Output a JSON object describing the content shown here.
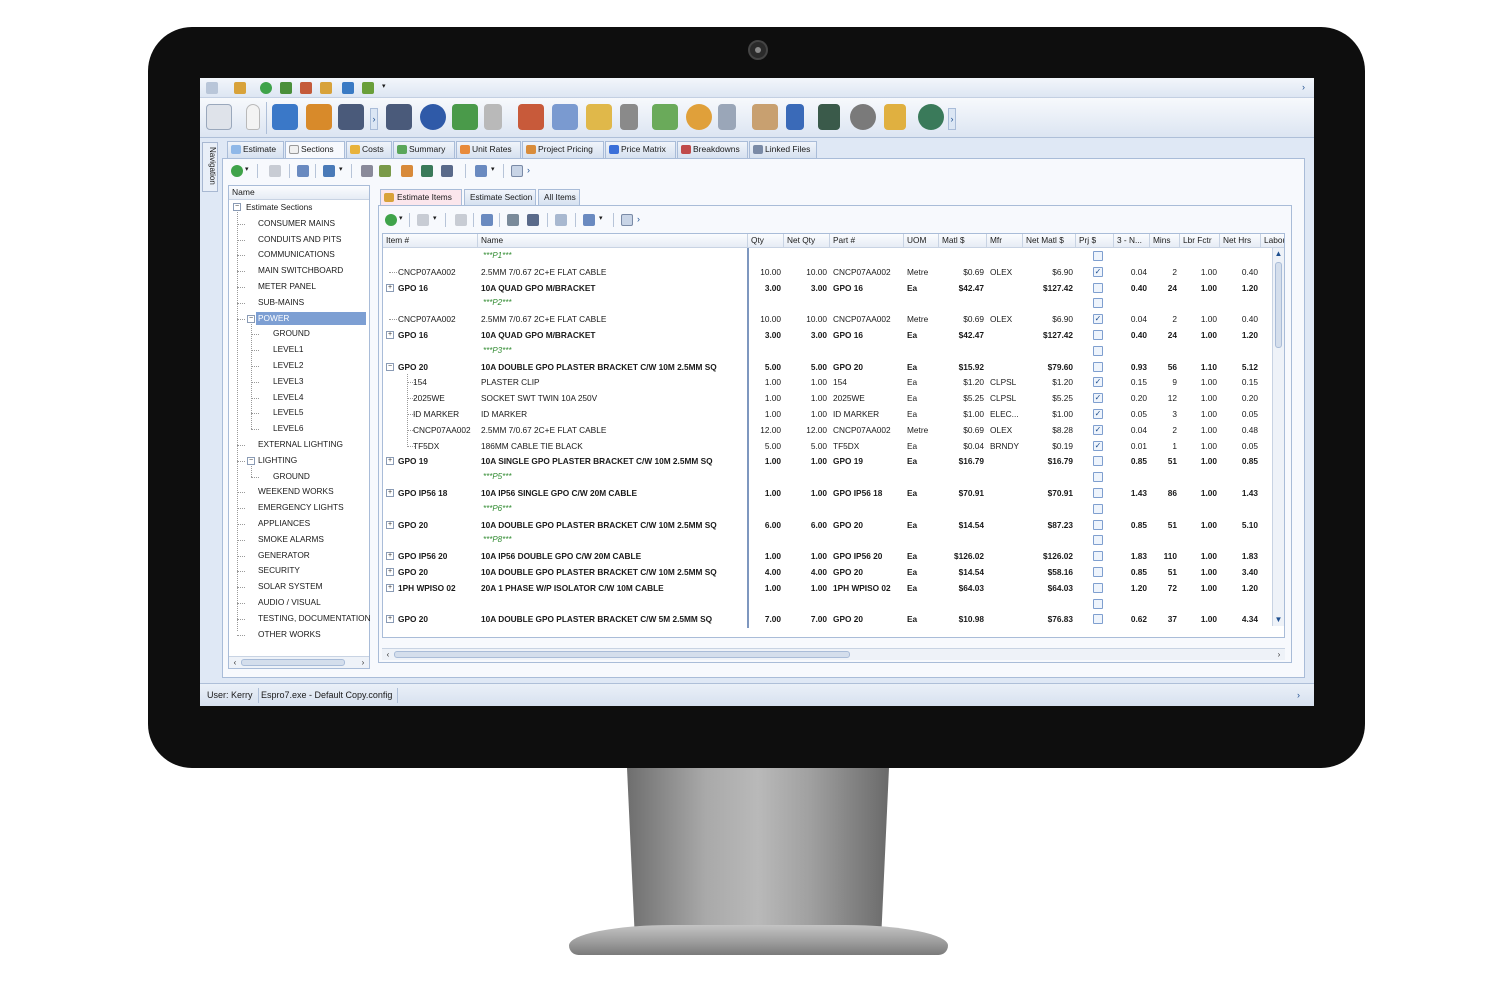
{
  "tabs": [
    {
      "label": "Estimate",
      "color": "#8fb8e8"
    },
    {
      "label": "Sections",
      "color": "#e06a8a"
    },
    {
      "label": "Costs",
      "color": "#e8b23a"
    },
    {
      "label": "Summary",
      "color": "#5aa65a"
    },
    {
      "label": "Unit Rates",
      "color": "#e88a3a"
    },
    {
      "label": "Project Pricing",
      "color": "#d98c3a"
    },
    {
      "label": "Price Matrix",
      "color": "#3a6fd9"
    },
    {
      "label": "Breakdowns",
      "color": "#c04a4a"
    },
    {
      "label": "Linked Files",
      "color": "#7a8aa6"
    }
  ],
  "active_tab": "Sections",
  "nav_label": "Navigation",
  "tree": {
    "header": "Name",
    "root": "Estimate Sections",
    "nodes": [
      {
        "label": "CONSUMER MAINS",
        "level": 1
      },
      {
        "label": "CONDUITS AND PITS",
        "level": 1
      },
      {
        "label": "COMMUNICATIONS",
        "level": 1
      },
      {
        "label": "MAIN SWITCHBOARD",
        "level": 1
      },
      {
        "label": "METER PANEL",
        "level": 1
      },
      {
        "label": "SUB-MAINS",
        "level": 1
      },
      {
        "label": "POWER",
        "level": 1,
        "expanded": true,
        "selected": true
      },
      {
        "label": "GROUND",
        "level": 2
      },
      {
        "label": "LEVEL1",
        "level": 2
      },
      {
        "label": "LEVEL2",
        "level": 2
      },
      {
        "label": "LEVEL3",
        "level": 2
      },
      {
        "label": "LEVEL4",
        "level": 2
      },
      {
        "label": "LEVEL5",
        "level": 2
      },
      {
        "label": "LEVEL6",
        "level": 2
      },
      {
        "label": "EXTERNAL LIGHTING",
        "level": 1
      },
      {
        "label": "LIGHTING",
        "level": 1,
        "expanded": true
      },
      {
        "label": "GROUND",
        "level": 2
      },
      {
        "label": "WEEKEND WORKS",
        "level": 1
      },
      {
        "label": "EMERGENCY LIGHTS",
        "level": 1
      },
      {
        "label": "APPLIANCES",
        "level": 1
      },
      {
        "label": "SMOKE ALARMS",
        "level": 1
      },
      {
        "label": "GENERATOR",
        "level": 1
      },
      {
        "label": "SECURITY",
        "level": 1
      },
      {
        "label": "SOLAR SYSTEM",
        "level": 1
      },
      {
        "label": "AUDIO / VISUAL",
        "level": 1
      },
      {
        "label": "TESTING, DOCUMENTATION",
        "level": 1
      },
      {
        "label": "OTHER WORKS",
        "level": 1
      }
    ]
  },
  "subtabs": [
    "Estimate Items",
    "Estimate Section",
    "All Items"
  ],
  "active_subtab": "Estimate Items",
  "grid": {
    "columns": [
      "Item #",
      "Name",
      "Qty",
      "Net Qty",
      "Part #",
      "UOM",
      "Matl $",
      "Mfr",
      "Net Matl $",
      "Prj $",
      "3 - N...",
      "Mins",
      "Lbr Fctr",
      "Net Hrs",
      "Labou"
    ],
    "rows": [
      {
        "kind": "p",
        "tag": "***P1***"
      },
      {
        "kind": "child",
        "item": "CNCP07AA002",
        "name": "2.5MM 7/0.67 2C+E FLAT CABLE",
        "qty": "10.00",
        "netqty": "10.00",
        "part": "CNCP07AA002",
        "uom": "Metre",
        "matl": "$0.69",
        "mfr": "OLEX",
        "netmatl": "$6.90",
        "prj": true,
        "n3": "0.04",
        "mins": "2",
        "lbr": "1.00",
        "nethrs": "0.40"
      },
      {
        "kind": "bold",
        "item": "GPO 16",
        "name": "10A QUAD GPO M/BRACKET",
        "qty": "3.00",
        "netqty": "3.00",
        "part": "GPO 16",
        "uom": "Ea",
        "matl": "$42.47",
        "mfr": "",
        "netmatl": "$127.42",
        "prj": false,
        "n3": "0.40",
        "mins": "24",
        "lbr": "1.00",
        "nethrs": "1.20"
      },
      {
        "kind": "p",
        "tag": "***P2***"
      },
      {
        "kind": "child",
        "item": "CNCP07AA002",
        "name": "2.5MM 7/0.67 2C+E FLAT CABLE",
        "qty": "10.00",
        "netqty": "10.00",
        "part": "CNCP07AA002",
        "uom": "Metre",
        "matl": "$0.69",
        "mfr": "OLEX",
        "netmatl": "$6.90",
        "prj": true,
        "n3": "0.04",
        "mins": "2",
        "lbr": "1.00",
        "nethrs": "0.40"
      },
      {
        "kind": "bold",
        "item": "GPO 16",
        "name": "10A QUAD GPO M/BRACKET",
        "qty": "3.00",
        "netqty": "3.00",
        "part": "GPO 16",
        "uom": "Ea",
        "matl": "$42.47",
        "mfr": "",
        "netmatl": "$127.42",
        "prj": false,
        "n3": "0.40",
        "mins": "24",
        "lbr": "1.00",
        "nethrs": "1.20"
      },
      {
        "kind": "p",
        "tag": "***P3***"
      },
      {
        "kind": "bold",
        "expanded": true,
        "item": "GPO 20",
        "name": "10A DOUBLE GPO PLASTER BRACKET C/W 10M 2.5MM SQ",
        "qty": "5.00",
        "netqty": "5.00",
        "part": "GPO 20",
        "uom": "Ea",
        "matl": "$15.92",
        "mfr": "",
        "netmatl": "$79.60",
        "prj": false,
        "n3": "0.93",
        "mins": "56",
        "lbr": "1.10",
        "nethrs": "5.12"
      },
      {
        "kind": "sub",
        "item": "154",
        "name": "PLASTER CLIP",
        "qty": "1.00",
        "netqty": "1.00",
        "part": "154",
        "uom": "Ea",
        "matl": "$1.20",
        "mfr": "CLPSL",
        "netmatl": "$1.20",
        "prj": true,
        "n3": "0.15",
        "mins": "9",
        "lbr": "1.00",
        "nethrs": "0.15"
      },
      {
        "kind": "sub",
        "item": "2025WE",
        "name": "SOCKET SWT TWIN 10A 250V",
        "qty": "1.00",
        "netqty": "1.00",
        "part": "2025WE",
        "uom": "Ea",
        "matl": "$5.25",
        "mfr": "CLPSL",
        "netmatl": "$5.25",
        "prj": true,
        "n3": "0.20",
        "mins": "12",
        "lbr": "1.00",
        "nethrs": "0.20"
      },
      {
        "kind": "sub",
        "item": "ID MARKER",
        "name": "ID MARKER",
        "qty": "1.00",
        "netqty": "1.00",
        "part": "ID MARKER",
        "uom": "Ea",
        "matl": "$1.00",
        "mfr": "ELEC...",
        "netmatl": "$1.00",
        "prj": true,
        "n3": "0.05",
        "mins": "3",
        "lbr": "1.00",
        "nethrs": "0.05"
      },
      {
        "kind": "sub",
        "item": "CNCP07AA002",
        "name": "2.5MM 7/0.67 2C+E FLAT CABLE",
        "qty": "12.00",
        "netqty": "12.00",
        "part": "CNCP07AA002",
        "uom": "Metre",
        "matl": "$0.69",
        "mfr": "OLEX",
        "netmatl": "$8.28",
        "prj": true,
        "n3": "0.04",
        "mins": "2",
        "lbr": "1.00",
        "nethrs": "0.48"
      },
      {
        "kind": "sub",
        "item": "TF5DX",
        "name": "186MM CABLE TIE BLACK",
        "qty": "5.00",
        "netqty": "5.00",
        "part": "TF5DX",
        "uom": "Ea",
        "matl": "$0.04",
        "mfr": "BRNDY",
        "netmatl": "$0.19",
        "prj": true,
        "n3": "0.01",
        "mins": "1",
        "lbr": "1.00",
        "nethrs": "0.05"
      },
      {
        "kind": "bold",
        "item": "GPO 19",
        "name": "10A SINGLE GPO PLASTER BRACKET C/W 10M 2.5MM SQ",
        "qty": "1.00",
        "netqty": "1.00",
        "part": "GPO 19",
        "uom": "Ea",
        "matl": "$16.79",
        "mfr": "",
        "netmatl": "$16.79",
        "prj": false,
        "n3": "0.85",
        "mins": "51",
        "lbr": "1.00",
        "nethrs": "0.85"
      },
      {
        "kind": "p",
        "tag": "***P5***"
      },
      {
        "kind": "bold",
        "item": "GPO IP56 18",
        "name": "10A IP56 SINGLE GPO C/W 20M CABLE",
        "qty": "1.00",
        "netqty": "1.00",
        "part": "GPO IP56 18",
        "uom": "Ea",
        "matl": "$70.91",
        "mfr": "",
        "netmatl": "$70.91",
        "prj": false,
        "n3": "1.43",
        "mins": "86",
        "lbr": "1.00",
        "nethrs": "1.43"
      },
      {
        "kind": "p",
        "tag": "***P6***"
      },
      {
        "kind": "bold",
        "item": "GPO 20",
        "name": "10A DOUBLE GPO PLASTER BRACKET C/W 10M 2.5MM SQ",
        "qty": "6.00",
        "netqty": "6.00",
        "part": "GPO 20",
        "uom": "Ea",
        "matl": "$14.54",
        "mfr": "",
        "netmatl": "$87.23",
        "prj": false,
        "n3": "0.85",
        "mins": "51",
        "lbr": "1.00",
        "nethrs": "5.10"
      },
      {
        "kind": "p",
        "tag": "***P8***"
      },
      {
        "kind": "bold",
        "item": "GPO IP56 20",
        "name": "10A IP56 DOUBLE GPO C/W 20M CABLE",
        "qty": "1.00",
        "netqty": "1.00",
        "part": "GPO IP56 20",
        "uom": "Ea",
        "matl": "$126.02",
        "mfr": "",
        "netmatl": "$126.02",
        "prj": false,
        "n3": "1.83",
        "mins": "110",
        "lbr": "1.00",
        "nethrs": "1.83"
      },
      {
        "kind": "bold",
        "item": "GPO 20",
        "name": "10A DOUBLE GPO PLASTER BRACKET C/W 10M 2.5MM SQ",
        "qty": "4.00",
        "netqty": "4.00",
        "part": "GPO 20",
        "uom": "Ea",
        "matl": "$14.54",
        "mfr": "",
        "netmatl": "$58.16",
        "prj": false,
        "n3": "0.85",
        "mins": "51",
        "lbr": "1.00",
        "nethrs": "3.40"
      },
      {
        "kind": "bold",
        "item": "1PH WPISO 02",
        "name": "20A 1 PHASE W/P ISOLATOR C/W 10M CABLE",
        "qty": "1.00",
        "netqty": "1.00",
        "part": "1PH WPISO 02",
        "uom": "Ea",
        "matl": "$64.03",
        "mfr": "",
        "netmatl": "$64.03",
        "prj": false,
        "n3": "1.20",
        "mins": "72",
        "lbr": "1.00",
        "nethrs": "1.20"
      },
      {
        "kind": "p",
        "tag": ""
      },
      {
        "kind": "bold",
        "item": "GPO 20",
        "name": "10A DOUBLE GPO PLASTER BRACKET C/W 5M 2.5MM SQ",
        "qty": "7.00",
        "netqty": "7.00",
        "part": "GPO 20",
        "uom": "Ea",
        "matl": "$10.98",
        "mfr": "",
        "netmatl": "$76.83",
        "prj": false,
        "n3": "0.62",
        "mins": "37",
        "lbr": "1.00",
        "nethrs": "4.34"
      }
    ]
  },
  "status": {
    "user": "User: Kerry",
    "config": "Espro7.exe - Default Copy.config"
  }
}
